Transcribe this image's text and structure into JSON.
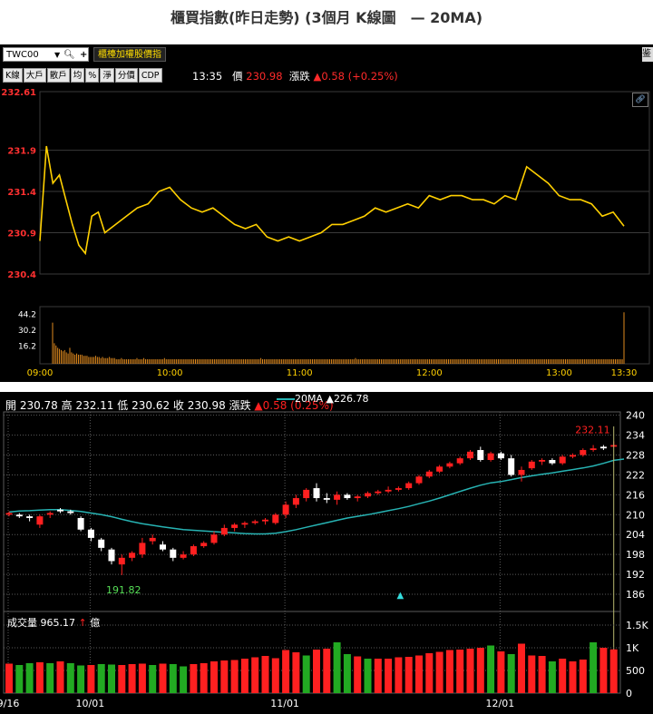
{
  "page_title": "櫃買指數(昨日走勢) (3個月 K線圖　— 20MA)",
  "intraday": {
    "symbol": "TWC00",
    "name_button": "櫃檯加權股價指",
    "buttons": [
      "K線",
      "大戶",
      "散戶",
      "均",
      "%",
      "淨",
      "分價",
      "CDP"
    ],
    "quote": {
      "time": "13:35",
      "price_label": "價",
      "price": "230.98",
      "change_label": "漲跌",
      "change": "▲0.58 (+0.25%)"
    },
    "corner_text": "鉴",
    "colors": {
      "line": "#ffd000",
      "volume": "#e08a1e",
      "axis_text": "#ff3030",
      "time_text": "#ffd000",
      "grid": "#3a3a3a"
    },
    "icons": [
      "dropdown-icon",
      "search-icon",
      "plus-icon",
      "link-icon"
    ]
  },
  "kline": {
    "header": {
      "open": "開 230.78",
      "high": "高 232.11",
      "low": "低 230.62",
      "close": "收 230.98",
      "change_label": "漲跌",
      "change": "▲0.58 (0.25%)",
      "ma_label": "20MA",
      "ma_value": "▲226.78"
    },
    "volume_header": {
      "label": "成交量 965.17",
      "unit": "億"
    },
    "annotations": {
      "high": "232.11",
      "low": "191.82"
    },
    "colors": {
      "up": "#ff2020",
      "down": "#ffffff",
      "vol_up": "#ff2020",
      "vol_down": "#22aa22",
      "ma": "#27b3b3",
      "grid": "#5a5a5a"
    }
  },
  "chart_data": [
    {
      "type": "line",
      "title": "",
      "x_ticks": [
        "09:00",
        "10:00",
        "11:00",
        "12:00",
        "13:00",
        "13:30"
      ],
      "y_ticks": [
        "232.61",
        "231.9",
        "231.4",
        "230.9",
        "230.4"
      ],
      "ylim": [
        230.4,
        232.61
      ],
      "grid": true,
      "series": [
        {
          "x": [
            "09:00",
            "09:03",
            "09:06",
            "09:09",
            "09:12",
            "09:15",
            "09:18",
            "09:21",
            "09:24",
            "09:27",
            "09:30",
            "09:35",
            "09:40",
            "09:45",
            "09:50",
            "09:55",
            "10:00",
            "10:05",
            "10:10",
            "10:15",
            "10:20",
            "10:25",
            "10:30",
            "10:35",
            "10:40",
            "10:45",
            "10:50",
            "10:55",
            "11:00",
            "11:05",
            "11:10",
            "11:15",
            "11:20",
            "11:25",
            "11:30",
            "11:35",
            "11:40",
            "11:45",
            "11:50",
            "11:55",
            "12:00",
            "12:05",
            "12:10",
            "12:15",
            "12:20",
            "12:25",
            "12:30",
            "12:35",
            "12:40",
            "12:45",
            "12:50",
            "12:55",
            "13:00",
            "13:05",
            "13:10",
            "13:15",
            "13:20",
            "13:25",
            "13:30"
          ],
          "values": [
            230.8,
            231.95,
            231.5,
            231.6,
            231.3,
            231.0,
            230.75,
            230.65,
            231.1,
            231.15,
            230.9,
            231.0,
            231.1,
            231.2,
            231.25,
            231.4,
            231.45,
            231.3,
            231.2,
            231.15,
            231.2,
            231.1,
            231.0,
            230.95,
            231.0,
            230.85,
            230.8,
            230.85,
            230.8,
            230.85,
            230.9,
            231.0,
            231.0,
            231.05,
            231.1,
            231.2,
            231.15,
            231.2,
            231.25,
            231.2,
            231.35,
            231.3,
            231.35,
            231.35,
            231.3,
            231.3,
            231.25,
            231.35,
            231.3,
            231.7,
            231.6,
            231.5,
            231.35,
            231.3,
            231.3,
            231.25,
            231.1,
            231.15,
            230.98
          ]
        }
      ],
      "volume": {
        "y_ticks": [
          "44.2",
          "30.2",
          "16.2"
        ],
        "ylim": [
          0,
          50
        ],
        "values": [
          36,
          18,
          16,
          14,
          13,
          12,
          11,
          12,
          10,
          9,
          14,
          10,
          9,
          8,
          9,
          8,
          8,
          8,
          7,
          7,
          7,
          6,
          6,
          6,
          6,
          7,
          6,
          6,
          5,
          6,
          5,
          5,
          5,
          6,
          5,
          5,
          5,
          4,
          4,
          4,
          5,
          4,
          4,
          4,
          4,
          4,
          4,
          4,
          4,
          5,
          4,
          4,
          4,
          5,
          4,
          4,
          4,
          4,
          4,
          4,
          4,
          4,
          4,
          4,
          4,
          5,
          4,
          4,
          4,
          4,
          4,
          4,
          4,
          4,
          4,
          4,
          4,
          4,
          4,
          4,
          4,
          4,
          4,
          4,
          4,
          4,
          4,
          4,
          4,
          4,
          4,
          4,
          4,
          4,
          4,
          4,
          4,
          4,
          4,
          4,
          4,
          4,
          4,
          4,
          4,
          4,
          4,
          4,
          4,
          4,
          4,
          4,
          4,
          4,
          4,
          4,
          4,
          4,
          4,
          4,
          4,
          5,
          4,
          4,
          4,
          4,
          4,
          4,
          4,
          4,
          4,
          4,
          4,
          4,
          4,
          4,
          4,
          4,
          4,
          4,
          4,
          4,
          4,
          4,
          4,
          4,
          4,
          4,
          4,
          4,
          4,
          4,
          4,
          4,
          4,
          4,
          4,
          4,
          4,
          4,
          4,
          4,
          4,
          4,
          4,
          4,
          4,
          4,
          4,
          4,
          4,
          4,
          4,
          4,
          4,
          4,
          5,
          4,
          4,
          4,
          4,
          4,
          4,
          4,
          4,
          4,
          4,
          4,
          4,
          4,
          4,
          4,
          4,
          4,
          4,
          4,
          4,
          4,
          4,
          4,
          4,
          4,
          4,
          4,
          4,
          4,
          4,
          4,
          4,
          4,
          4,
          4,
          4,
          4,
          4,
          4,
          4,
          4,
          4,
          4,
          4,
          4,
          4,
          4,
          4,
          4,
          4,
          4,
          4,
          4,
          4,
          4,
          4,
          4,
          4,
          4,
          4,
          4,
          4,
          4,
          4,
          4,
          4,
          4,
          4,
          4,
          4,
          4,
          4,
          4,
          4,
          4,
          4,
          4,
          4,
          4,
          4,
          4,
          4,
          4,
          4,
          4,
          4,
          4,
          4,
          4,
          4,
          4,
          4,
          4,
          4,
          4,
          4,
          4,
          4,
          4,
          4,
          4,
          4,
          4,
          4,
          4,
          4,
          4,
          4,
          4,
          4,
          4,
          4,
          4,
          4,
          4,
          4,
          4,
          4,
          4,
          4,
          4,
          4,
          4,
          4,
          4,
          4,
          4,
          4,
          4,
          4,
          4,
          4,
          4,
          4,
          4,
          4,
          4,
          4,
          4,
          4,
          4,
          4,
          4,
          4,
          4,
          4,
          4,
          4,
          4,
          4,
          4,
          4,
          4,
          4,
          4,
          45
        ]
      }
    },
    {
      "type": "candlestick",
      "title": "",
      "x_ticks": [
        "9/16",
        "10/01",
        "11/01",
        "12/01"
      ],
      "y_ticks": [
        "240",
        "234",
        "228",
        "222",
        "216",
        "210",
        "204",
        "198",
        "192",
        "186"
      ],
      "ylim": [
        183,
        241
      ],
      "grid": true,
      "candles": [
        {
          "o": 210,
          "h": 211,
          "l": 209.5,
          "c": 210.5
        },
        {
          "o": 210,
          "h": 210.5,
          "l": 209,
          "c": 209.5
        },
        {
          "o": 209.5,
          "h": 210,
          "l": 208,
          "c": 209
        },
        {
          "o": 207,
          "h": 210,
          "l": 206,
          "c": 209.5
        },
        {
          "o": 210,
          "h": 211,
          "l": 209,
          "c": 210.5
        },
        {
          "o": 211.5,
          "h": 212,
          "l": 210.5,
          "c": 211
        },
        {
          "o": 211,
          "h": 211.5,
          "l": 210,
          "c": 210.5
        },
        {
          "o": 209,
          "h": 209.5,
          "l": 205,
          "c": 205.5
        },
        {
          "o": 205.5,
          "h": 206,
          "l": 202,
          "c": 203
        },
        {
          "o": 202.5,
          "h": 203,
          "l": 199,
          "c": 200
        },
        {
          "o": 199.5,
          "h": 200,
          "l": 195,
          "c": 196
        },
        {
          "o": 195,
          "h": 198,
          "l": 191.8,
          "c": 197
        },
        {
          "o": 197,
          "h": 199,
          "l": 196,
          "c": 198.5
        },
        {
          "o": 198,
          "h": 203,
          "l": 197,
          "c": 201.5
        },
        {
          "o": 202,
          "h": 204,
          "l": 201,
          "c": 203
        },
        {
          "o": 201,
          "h": 202,
          "l": 199,
          "c": 199.5
        },
        {
          "o": 199.5,
          "h": 200,
          "l": 196,
          "c": 197
        },
        {
          "o": 197,
          "h": 199,
          "l": 196.5,
          "c": 198
        },
        {
          "o": 198,
          "h": 201,
          "l": 197.5,
          "c": 200.5
        },
        {
          "o": 200.5,
          "h": 202,
          "l": 200,
          "c": 201.5
        },
        {
          "o": 201.5,
          "h": 205,
          "l": 201,
          "c": 204
        },
        {
          "o": 204,
          "h": 207,
          "l": 203.5,
          "c": 206
        },
        {
          "o": 206,
          "h": 207.5,
          "l": 205,
          "c": 207
        },
        {
          "o": 207,
          "h": 208,
          "l": 206,
          "c": 207.5
        },
        {
          "o": 207.5,
          "h": 208.5,
          "l": 207,
          "c": 208
        },
        {
          "o": 208,
          "h": 209,
          "l": 207,
          "c": 208.5
        },
        {
          "o": 207.5,
          "h": 210.5,
          "l": 207,
          "c": 210
        },
        {
          "o": 210,
          "h": 214,
          "l": 209,
          "c": 213
        },
        {
          "o": 213,
          "h": 216,
          "l": 212,
          "c": 215
        },
        {
          "o": 215,
          "h": 218,
          "l": 214,
          "c": 217.5
        },
        {
          "o": 218,
          "h": 219.5,
          "l": 214,
          "c": 215
        },
        {
          "o": 215,
          "h": 216.5,
          "l": 213.5,
          "c": 214.5
        },
        {
          "o": 214.5,
          "h": 217,
          "l": 213,
          "c": 216
        },
        {
          "o": 216,
          "h": 216.5,
          "l": 214.5,
          "c": 215
        },
        {
          "o": 215,
          "h": 216,
          "l": 214,
          "c": 215.5
        },
        {
          "o": 215.5,
          "h": 217,
          "l": 215,
          "c": 216.5
        },
        {
          "o": 216.5,
          "h": 217.5,
          "l": 216,
          "c": 217
        },
        {
          "o": 217,
          "h": 218.5,
          "l": 216.5,
          "c": 217.5
        },
        {
          "o": 217.5,
          "h": 218.5,
          "l": 217,
          "c": 218
        },
        {
          "o": 218,
          "h": 220,
          "l": 217.5,
          "c": 219.5
        },
        {
          "o": 219.5,
          "h": 222,
          "l": 219,
          "c": 221.5
        },
        {
          "o": 221.5,
          "h": 223.5,
          "l": 221,
          "c": 223
        },
        {
          "o": 223,
          "h": 225,
          "l": 222.5,
          "c": 224.5
        },
        {
          "o": 224.5,
          "h": 226,
          "l": 224,
          "c": 225.5
        },
        {
          "o": 225.5,
          "h": 227.5,
          "l": 225,
          "c": 227
        },
        {
          "o": 227,
          "h": 229.5,
          "l": 226.5,
          "c": 229
        },
        {
          "o": 229.5,
          "h": 230.5,
          "l": 226,
          "c": 226.5
        },
        {
          "o": 226.5,
          "h": 229,
          "l": 226,
          "c": 228.5
        },
        {
          "o": 228.5,
          "h": 229,
          "l": 226.5,
          "c": 227
        },
        {
          "o": 227,
          "h": 228,
          "l": 221.5,
          "c": 222
        },
        {
          "o": 222,
          "h": 224.5,
          "l": 220,
          "c": 223.5
        },
        {
          "o": 224,
          "h": 226.5,
          "l": 223.5,
          "c": 226
        },
        {
          "o": 226,
          "h": 227,
          "l": 225,
          "c": 226.5
        },
        {
          "o": 226.5,
          "h": 227,
          "l": 225,
          "c": 225.5
        },
        {
          "o": 225.5,
          "h": 228,
          "l": 225,
          "c": 227.5
        },
        {
          "o": 227.5,
          "h": 228.5,
          "l": 227,
          "c": 228
        },
        {
          "o": 228,
          "h": 230,
          "l": 227.5,
          "c": 229.5
        },
        {
          "o": 229.5,
          "h": 231,
          "l": 229,
          "c": 230
        },
        {
          "o": 230.5,
          "h": 231,
          "l": 229.5,
          "c": 230
        },
        {
          "o": 230.5,
          "h": 232.11,
          "l": 230.5,
          "c": 231
        }
      ],
      "ma20": [
        210.8,
        211.1,
        211.2,
        211.4,
        211.5,
        211.5,
        211.3,
        211.0,
        210.5,
        210.0,
        209.4,
        208.6,
        207.9,
        207.3,
        206.8,
        206.3,
        205.9,
        205.5,
        205.3,
        205.1,
        204.9,
        204.7,
        204.5,
        204.3,
        204.2,
        204.2,
        204.4,
        204.9,
        205.5,
        206.2,
        206.9,
        207.6,
        208.3,
        209.0,
        209.5,
        210.0,
        210.6,
        211.2,
        211.8,
        212.5,
        213.3,
        214.1,
        215.0,
        216.0,
        217.0,
        218.0,
        218.9,
        219.6,
        220.0,
        220.6,
        221.2,
        221.7,
        222.2,
        222.6,
        223.1,
        223.6,
        224.1,
        224.7,
        225.5,
        226.4,
        226.78
      ],
      "volume": {
        "unit": "億",
        "y_ticks": [
          "1.5K",
          "1K",
          "500",
          "0"
        ],
        "ylim": [
          0,
          1600
        ],
        "values": [
          650,
          620,
          660,
          680,
          660,
          700,
          660,
          610,
          620,
          640,
          630,
          620,
          640,
          650,
          620,
          650,
          640,
          590,
          640,
          660,
          700,
          720,
          730,
          760,
          790,
          820,
          770,
          950,
          900,
          830,
          960,
          980,
          1120,
          860,
          810,
          760,
          760,
          760,
          790,
          800,
          830,
          880,
          910,
          950,
          960,
          980,
          1000,
          1050,
          920,
          860,
          1090,
          830,
          820,
          700,
          760,
          700,
          740,
          1120,
          1000,
          965
        ],
        "up": [
          true,
          false,
          false,
          true,
          false,
          true,
          false,
          false,
          true,
          false,
          false,
          true,
          true,
          true,
          false,
          true,
          false,
          false,
          true,
          true,
          true,
          true,
          true,
          true,
          true,
          true,
          true,
          true,
          true,
          false,
          true,
          true,
          false,
          false,
          true,
          false,
          true,
          true,
          true,
          true,
          true,
          true,
          true,
          true,
          true,
          true,
          true,
          false,
          true,
          false,
          true,
          true,
          true,
          false,
          true,
          true,
          true,
          false,
          true,
          true
        ]
      }
    }
  ]
}
